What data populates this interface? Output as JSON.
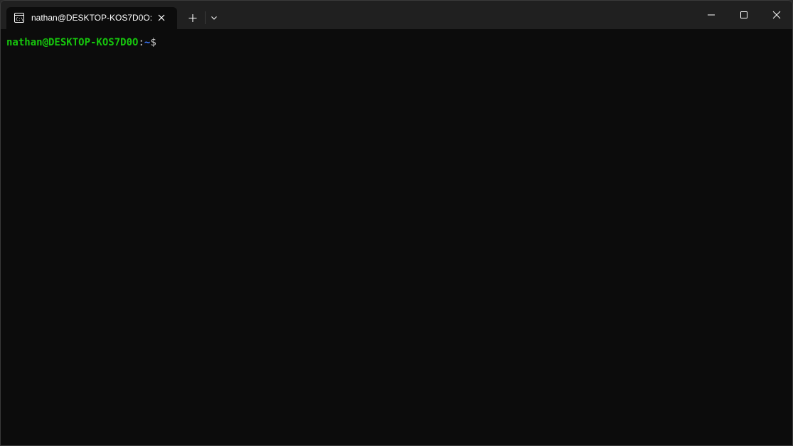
{
  "window": {
    "tab_title": "nathan@DESKTOP-KOS7D0O: ~",
    "tab_icon": "terminal-icon",
    "new_tab_icon": "plus-icon",
    "dropdown_icon": "chevron-down-icon",
    "minimize_icon": "minimize-icon",
    "maximize_icon": "maximize-icon",
    "close_icon": "close-icon"
  },
  "terminal": {
    "prompt_user_host": "nathan@DESKTOP-KOS7D0O",
    "prompt_colon": ":",
    "prompt_path": "~",
    "prompt_symbol": "$"
  },
  "colors": {
    "background": "#0c0c0c",
    "titlebar": "#202020",
    "prompt_user": "#16c60c",
    "prompt_path": "#3b78ff",
    "foreground": "#cccccc"
  }
}
